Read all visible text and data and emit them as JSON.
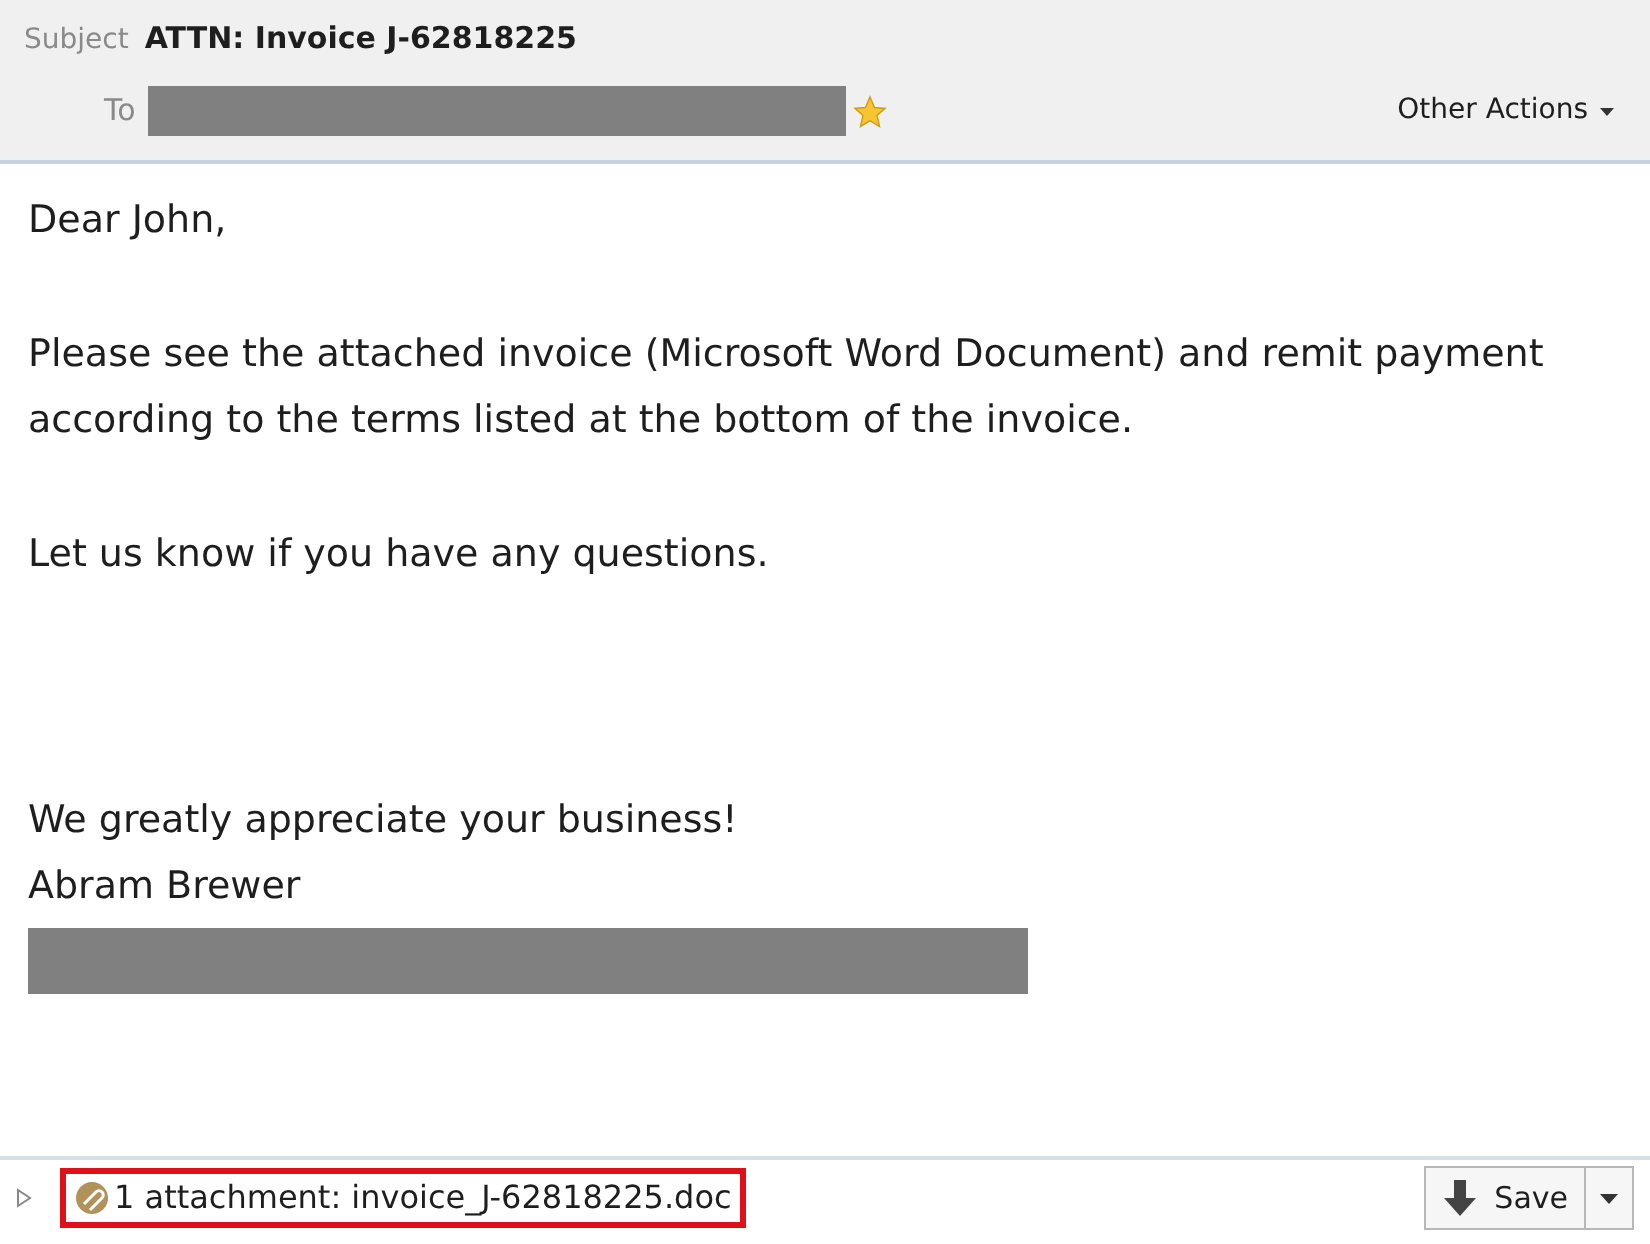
{
  "header": {
    "subject_label": "Subject",
    "subject": "ATTN: Invoice J-62818225",
    "to_label": "To",
    "starred": true,
    "other_actions": "Other Actions"
  },
  "body": [
    {
      "kind": "greeting",
      "text": "Dear John,"
    },
    {
      "kind": "paragraph",
      "text": "Please see the attached invoice (Microsoft Word Document) and remit payment according to the terms listed at the bottom of the invoice."
    },
    {
      "kind": "paragraph",
      "text": "Let us know if you have any questions."
    },
    {
      "kind": "signature",
      "text": "We greatly appreciate your business!"
    },
    {
      "kind": "name",
      "text": "Abram Brewer"
    }
  ],
  "attachment": {
    "label": "1 attachment: invoice_J-62818225.doc",
    "highlighted": true
  },
  "save_button": "Save"
}
